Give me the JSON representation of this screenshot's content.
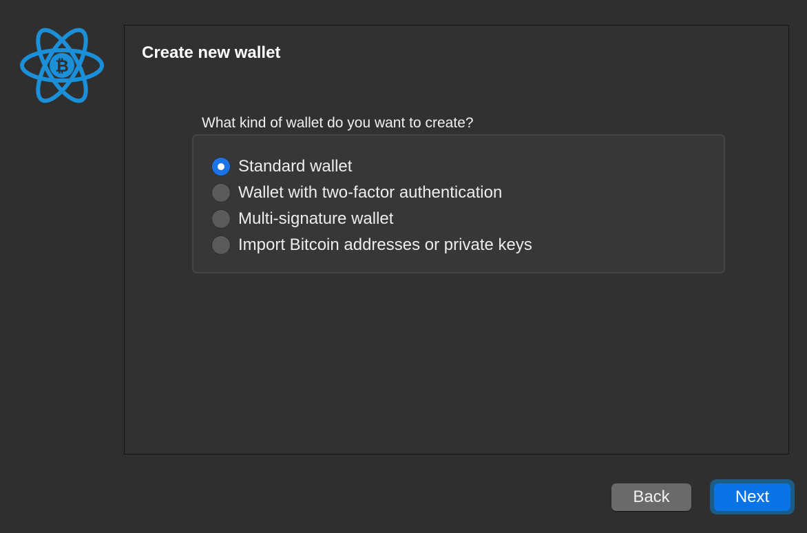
{
  "wizard": {
    "title": "Create new wallet",
    "question": "What kind of wallet do you want to create?",
    "options": [
      {
        "label": "Standard wallet",
        "checked": true
      },
      {
        "label": "Wallet with two-factor authentication",
        "checked": false
      },
      {
        "label": "Multi-signature wallet",
        "checked": false
      },
      {
        "label": "Import Bitcoin addresses or private keys",
        "checked": false
      }
    ]
  },
  "buttons": {
    "back_label": "Back",
    "next_label": "Next"
  },
  "logo": {
    "icon": "electrum-bitcoin-logo-icon",
    "symbol": "₿",
    "color": "#1b8fd8"
  },
  "colors": {
    "accent": "#0a73e6",
    "background": "#2f2f2f",
    "panel": "#313131"
  }
}
